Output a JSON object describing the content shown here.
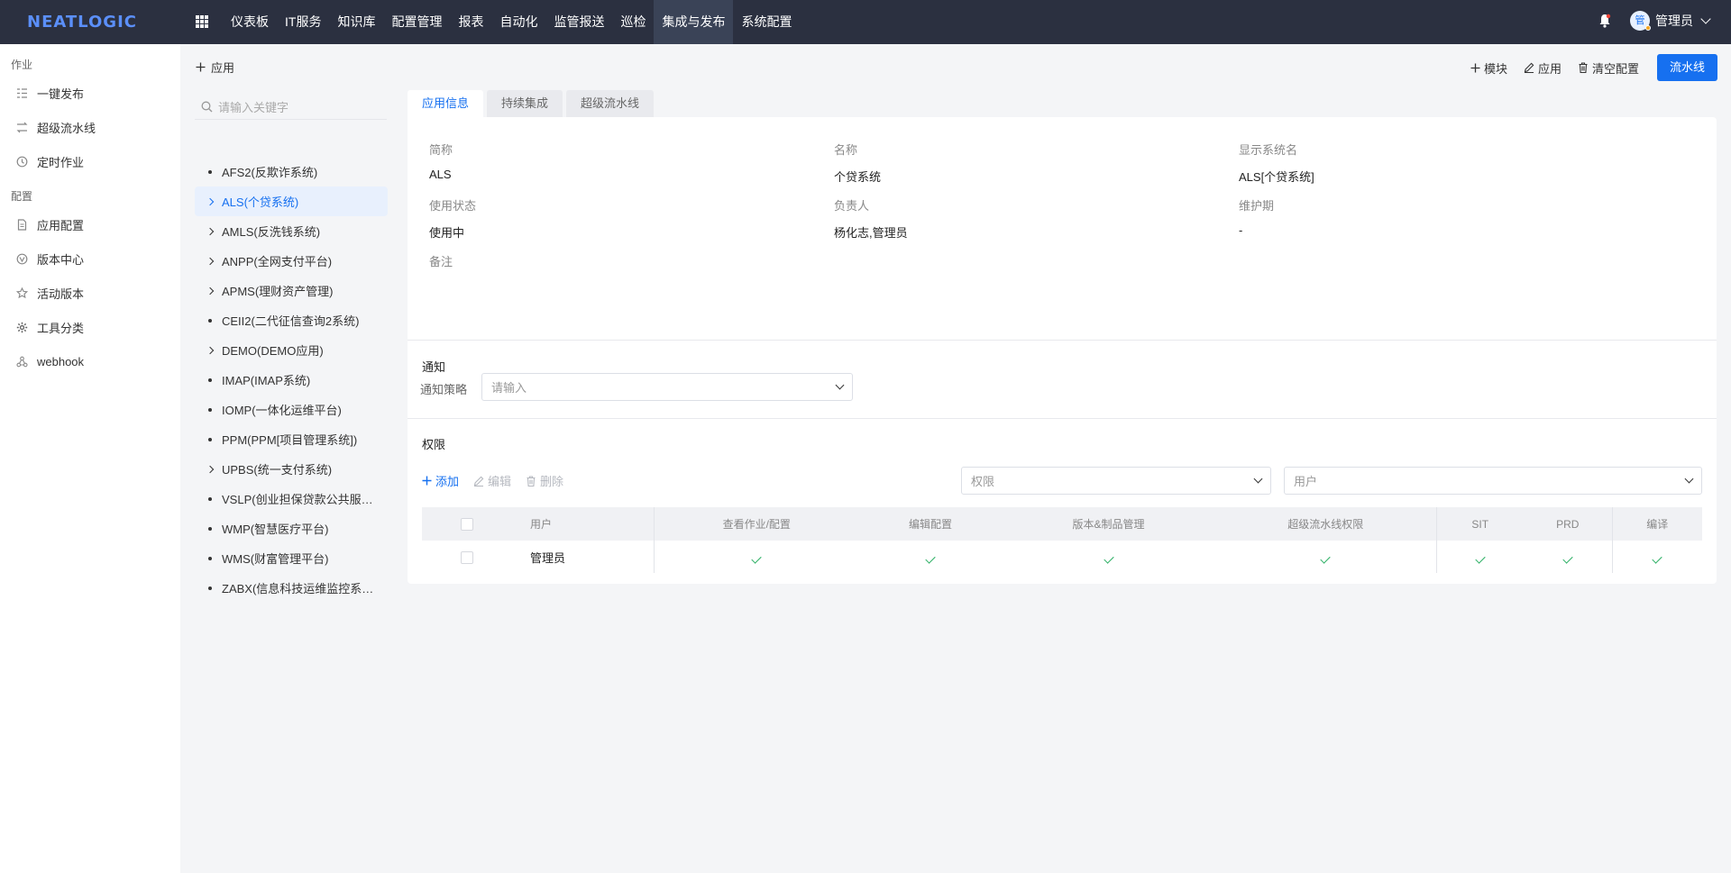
{
  "brand": {
    "logo": "NEATLOGIC"
  },
  "topnav": {
    "items": [
      "仪表板",
      "IT服务",
      "知识库",
      "配置管理",
      "报表",
      "自动化",
      "监管报送",
      "巡检",
      "集成与发布",
      "系统配置"
    ],
    "active": "集成与发布",
    "user": {
      "name": "管理员",
      "avatar_text": "管"
    }
  },
  "sidebar": {
    "group1": "作业",
    "group1_items": [
      "一键发布",
      "超级流水线",
      "定时作业"
    ],
    "group2": "配置",
    "group2_items": [
      "应用配置",
      "版本中心",
      "活动版本",
      "工具分类",
      "webhook"
    ]
  },
  "tree": {
    "add_label": "应用",
    "search_placeholder": "请输入关键字",
    "items": [
      {
        "label": "AFS2(反欺诈系统)",
        "type": "leaf"
      },
      {
        "label": "ALS(个贷系统)",
        "type": "branch",
        "active": true
      },
      {
        "label": "AMLS(反洗钱系统)",
        "type": "branch"
      },
      {
        "label": "ANPP(全网支付平台)",
        "type": "branch"
      },
      {
        "label": "APMS(理财资产管理)",
        "type": "branch"
      },
      {
        "label": "CEII2(二代征信查询2系统)",
        "type": "leaf"
      },
      {
        "label": "DEMO(DEMO应用)",
        "type": "branch"
      },
      {
        "label": "IMAP(IMAP系统)",
        "type": "leaf"
      },
      {
        "label": "IOMP(一体化运维平台)",
        "type": "leaf"
      },
      {
        "label": "PPM(PPM[项目管理系统])",
        "type": "leaf"
      },
      {
        "label": "UPBS(统一支付系统)",
        "type": "branch"
      },
      {
        "label": "VSLP(创业担保贷款公共服…",
        "type": "leaf"
      },
      {
        "label": "WMP(智慧医疗平台)",
        "type": "leaf"
      },
      {
        "label": "WMS(财富管理平台)",
        "type": "leaf"
      },
      {
        "label": "ZABX(信息科技运维监控系…",
        "type": "leaf"
      }
    ]
  },
  "actions": {
    "module": "模块",
    "app": "应用",
    "clear": "清空配置",
    "pipeline": "流水线"
  },
  "tabs": [
    "应用信息",
    "持续集成",
    "超级流水线"
  ],
  "info": {
    "abbr_label": "简称",
    "abbr": "ALS",
    "name_label": "名称",
    "name": "个贷系统",
    "display_label": "显示系统名",
    "display": "ALS[个贷系统]",
    "status_label": "使用状态",
    "status": "使用中",
    "owner_label": "负责人",
    "owner": "杨化志,管理员",
    "maint_label": "维护期",
    "maint": "-",
    "remark_label": "备注"
  },
  "notify": {
    "title": "通知",
    "policy_label": "通知策略",
    "policy_placeholder": "请输入"
  },
  "perm": {
    "title": "权限",
    "add": "添加",
    "edit": "编辑",
    "delete": "删除",
    "filter_perm": "权限",
    "filter_user": "用户",
    "columns": [
      "用户",
      "查看作业/配置",
      "编辑配置",
      "版本&制品管理",
      "超级流水线权限",
      "SIT",
      "PRD",
      "编译"
    ],
    "rows": [
      {
        "user": "管理员"
      }
    ]
  },
  "colors": {
    "primary": "#1670f0",
    "topbar": "#2b3040",
    "check": "#27ae60"
  }
}
